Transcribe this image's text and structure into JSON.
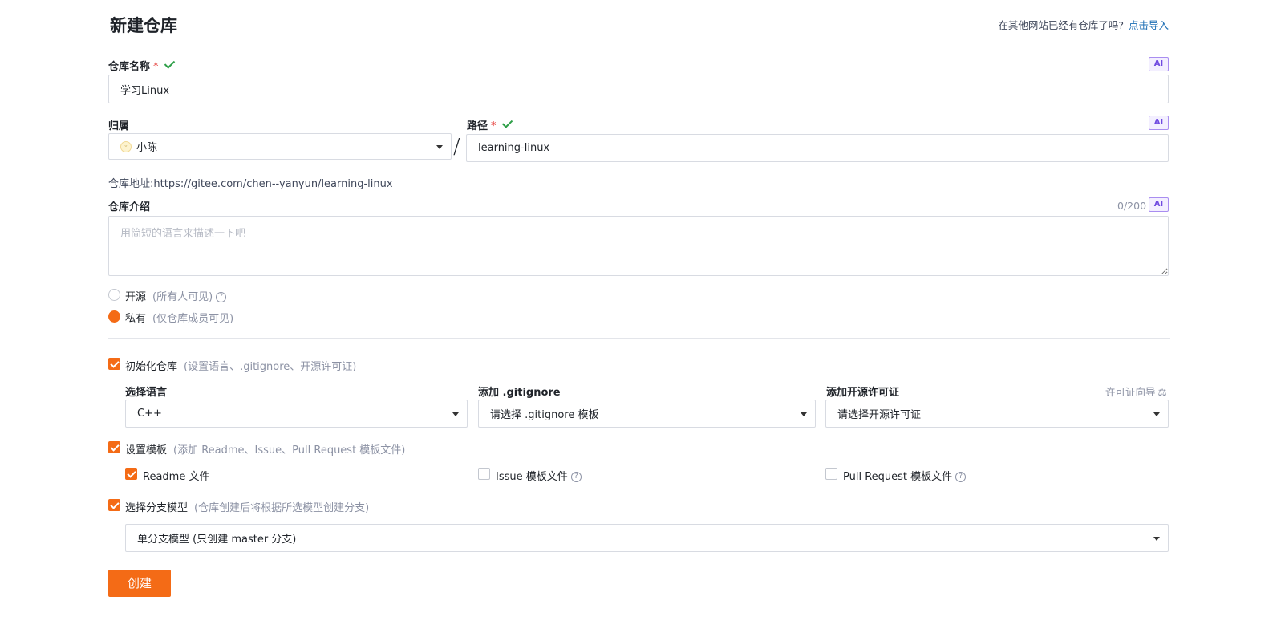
{
  "page_title": "新建仓库",
  "import": {
    "hint": "在其他网站已经有仓库了吗?",
    "link": "点击导入"
  },
  "ai_badge": "AI",
  "repo_name": {
    "label": "仓库名称",
    "required": "*",
    "value": "学习Linux"
  },
  "owner": {
    "label": "归属",
    "value": "小陈"
  },
  "path": {
    "label": "路径",
    "required": "*",
    "value": "learning-linux",
    "separator": "/"
  },
  "repo_url": "仓库地址:https://gitee.com/chen--yanyun/learning-linux",
  "description": {
    "label": "仓库介绍",
    "counter": "0/200",
    "placeholder": "用简短的语言来描述一下吧"
  },
  "visibility": {
    "public": {
      "label": "开源",
      "hint": "(所有人可见)",
      "selected": false
    },
    "private": {
      "label": "私有",
      "hint": "(仅仓库成员可见)",
      "selected": true
    }
  },
  "init_repo": {
    "label": "初始化仓库",
    "hint": "(设置语言、.gitignore、开源许可证)",
    "checked": true
  },
  "language": {
    "label": "选择语言",
    "value": "C++"
  },
  "gitignore": {
    "label": "添加 .gitignore",
    "value": "请选择 .gitignore 模板"
  },
  "license": {
    "label": "添加开源许可证",
    "guide": "许可证向导",
    "value": "请选择开源许可证"
  },
  "templates": {
    "label": "设置模板",
    "hint": "(添加 Readme、Issue、Pull Request 模板文件)",
    "checked": true,
    "readme": {
      "label": "Readme 文件",
      "checked": true
    },
    "issue": {
      "label": "Issue 模板文件",
      "checked": false
    },
    "pr": {
      "label": "Pull Request 模板文件",
      "checked": false
    }
  },
  "branch_model": {
    "label": "选择分支模型",
    "hint": "(仓库创建后将根据所选模型创建分支)",
    "checked": true,
    "value": "单分支模型 (只创建 master 分支)"
  },
  "submit": "创建",
  "colors": {
    "accent": "#f46b16",
    "link": "#1e6fb5",
    "success": "#2e9f48"
  }
}
